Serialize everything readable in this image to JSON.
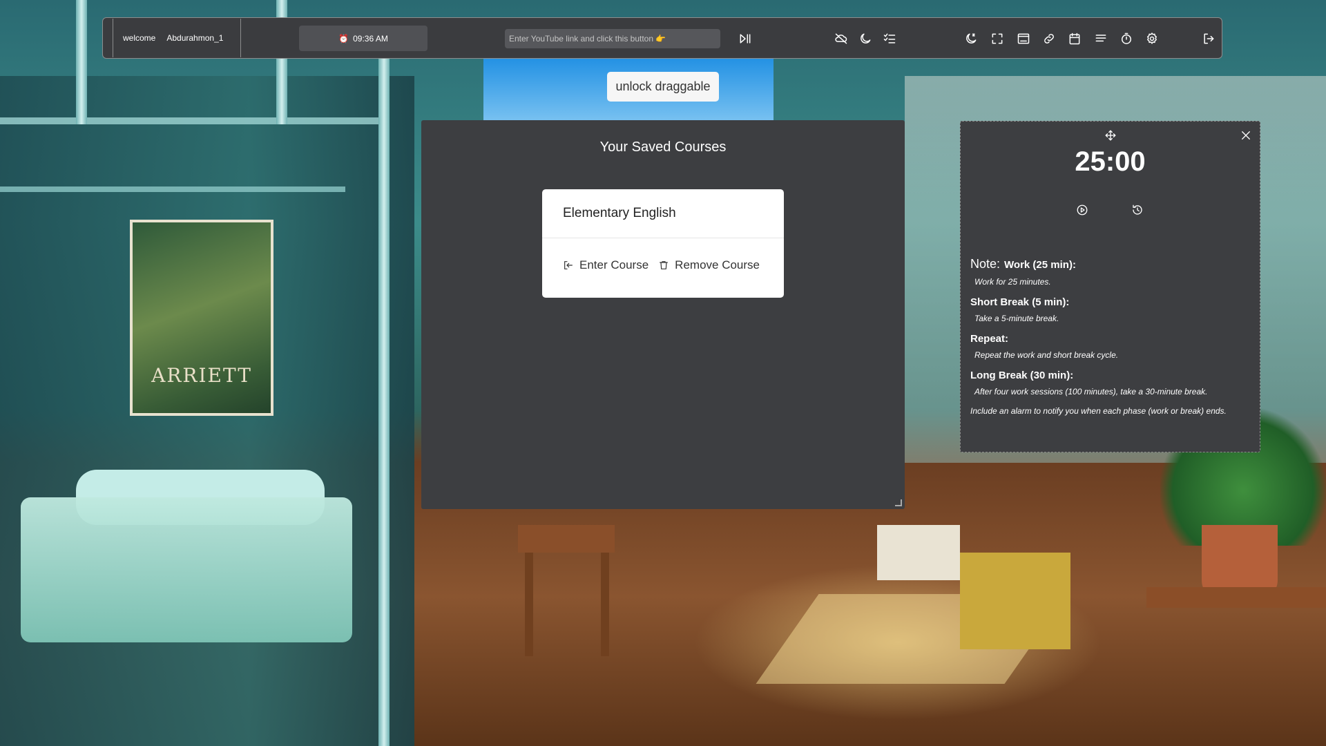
{
  "toolbar": {
    "welcome_label": "welcome",
    "username": "Abdurahmon_1",
    "clock_time": "09:36 AM",
    "youtube_placeholder": "Enter YouTube link and click this button 👉"
  },
  "icons": {
    "play_pause": "play-pause-icon",
    "weather": "cloud-icon",
    "moon": "moon-icon",
    "checklist": "checklist-icon",
    "sleep": "moon-icon",
    "fullscreen": "fullscreen-icon",
    "window": "window-icon",
    "link": "link-icon",
    "calendar": "calendar-icon",
    "notes": "lines-icon",
    "timer": "stopwatch-icon",
    "settings": "gear-icon",
    "logout": "logout-icon"
  },
  "unlock_button": "unlock draggable",
  "courses": {
    "title": "Your Saved Courses",
    "items": [
      {
        "name": "Elementary English",
        "enter_label": "Enter Course",
        "remove_label": "Remove Course"
      }
    ]
  },
  "pomodoro": {
    "time": "25:00",
    "note_label": "Note:",
    "sections": [
      {
        "heading": "Work (25 min):",
        "text": "Work for 25 minutes."
      },
      {
        "heading": "Short Break (5 min):",
        "text": "Take a 5-minute break."
      },
      {
        "heading": "Repeat:",
        "text": "Repeat the work and short break cycle."
      },
      {
        "heading": "Long Break (30 min):",
        "text": "After four work sessions (100 minutes), take a 30-minute break."
      }
    ],
    "footer": "Include an alarm to notify you when each phase (work or break) ends."
  },
  "background": {
    "poster_text": "ARRIETT"
  },
  "colors": {
    "toolbar_bg": "#3b3c3f",
    "panel_bg": "#3d3e41",
    "alarm_red": "#ff5a4e"
  }
}
